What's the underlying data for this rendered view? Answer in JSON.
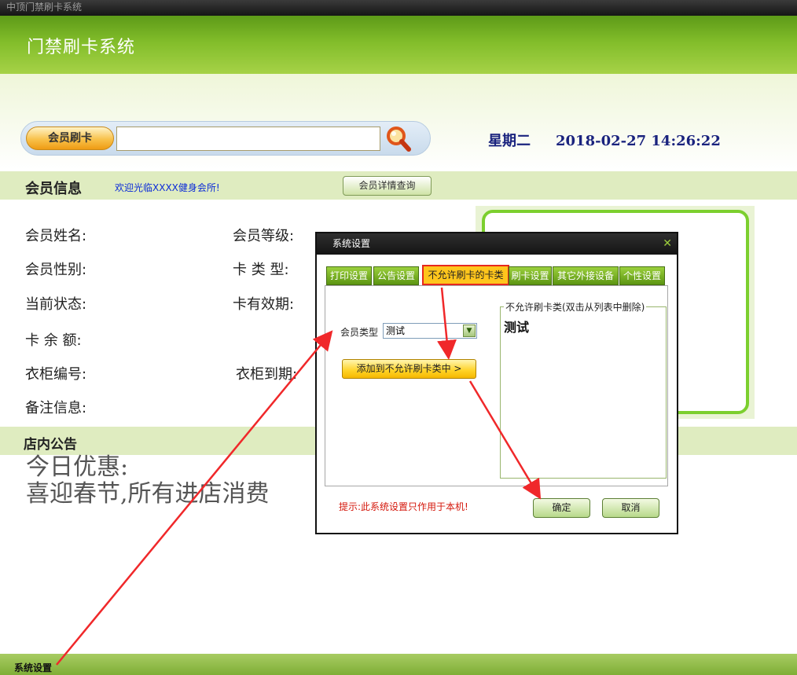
{
  "window": {
    "title": "中顶门禁刷卡系统"
  },
  "header": {
    "title": "门禁刷卡系统"
  },
  "search": {
    "swipe_label": "会员刷卡",
    "value": "",
    "placeholder": "",
    "search_icon": "magnifier-icon"
  },
  "clock": {
    "weekday": "星期二",
    "datetime": "2018-02-27 14:26:22"
  },
  "member": {
    "section_title": "会员信息",
    "welcome": "欢迎光临XXXX健身会所!",
    "detail_button": "会员详情查询",
    "fields": {
      "name": "会员姓名:",
      "gender": "会员性别:",
      "status": "当前状态:",
      "balance": "卡 余 额:",
      "locker_no": "衣柜编号:",
      "remark": "备注信息:",
      "level": "会员等级:",
      "card_type": "卡 类 型:",
      "validity": "卡有效期:",
      "locker_expiry": "衣柜到期:"
    }
  },
  "notice": {
    "section_title": "店内公告",
    "line1": "今日优惠:",
    "line2": "喜迎春节,所有进店消费"
  },
  "footer": {
    "settings_label": "系统设置"
  },
  "dialog": {
    "title": "系统设置",
    "close_glyph": "✕",
    "tabs": [
      "打印设置",
      "公告设置",
      "不允许刷卡的卡类",
      "刷卡设置",
      "其它外接设备",
      "个性设置"
    ],
    "active_tab": "不允许刷卡的卡类",
    "member_type_label": "会员类型",
    "member_type_value": "测试",
    "add_button": "添加到不允许刷卡类中 >",
    "group_title": "不允许刷卡类(双击从列表中删除)",
    "list_items": [
      "测试"
    ],
    "hint": "提示:此系统设置只作用于本机!",
    "ok": "确定",
    "cancel": "取消"
  },
  "colors": {
    "brand_green": "#82bd2a",
    "accent_orange": "#ffc51c",
    "annotation_red": "#e6281e"
  }
}
